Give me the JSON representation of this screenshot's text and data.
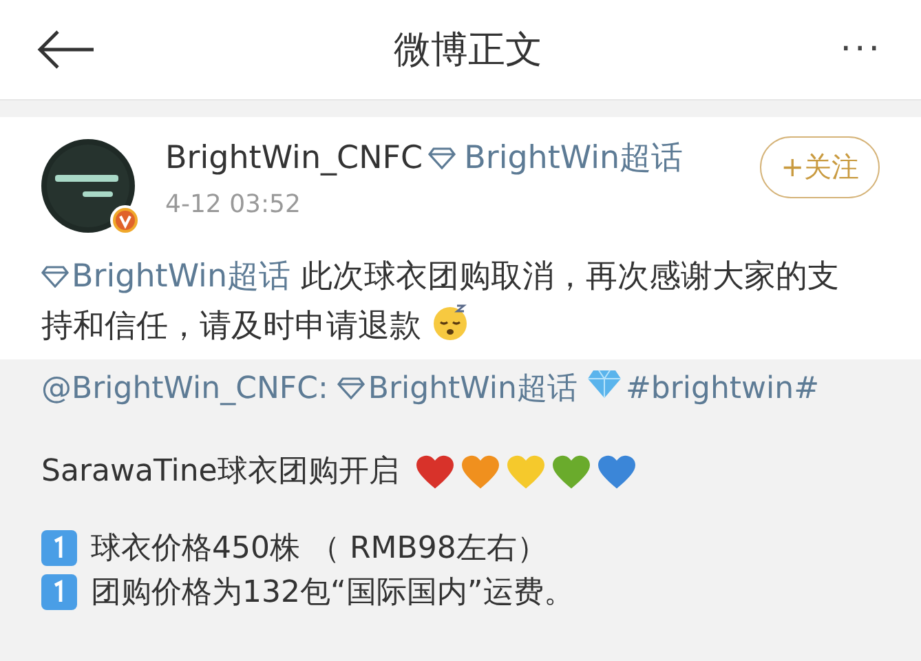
{
  "header": {
    "title": "微博正文",
    "more": "···"
  },
  "post": {
    "author": "BrightWin_CNFC",
    "author_topic": "BrightWin超话",
    "time": "4-12 03:52",
    "follow": "+关注",
    "topic": "BrightWin超话",
    "text": "此次球衣团购取消，再次感谢大家的支持和信任，请及时申请退款"
  },
  "repost": {
    "mention": "@BrightWin_CNFC:",
    "topic": "BrightWin超话",
    "hashtag": "#brightwin#",
    "headline": "SarawaTine球衣团购开启",
    "hearts": [
      {
        "color": "#d8322a"
      },
      {
        "color": "#f0901e"
      },
      {
        "color": "#f5c92c"
      },
      {
        "color": "#6aab2c"
      },
      {
        "color": "#3b86d8"
      }
    ],
    "items": [
      "球衣价格450株 （ RMB98左右）",
      "团购价格为132包“国际国内”运费。"
    ]
  }
}
